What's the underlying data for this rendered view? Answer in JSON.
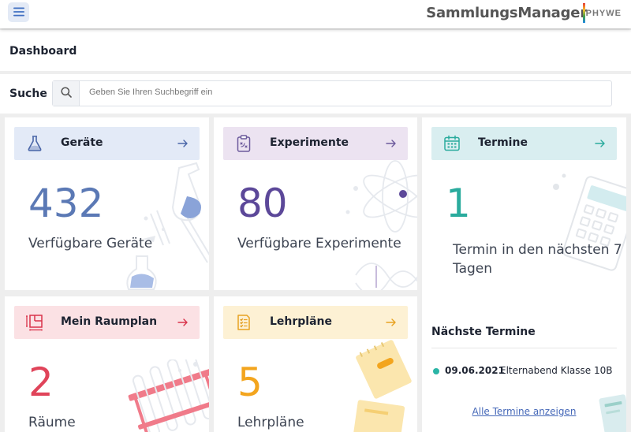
{
  "header": {
    "app_title": "SammlungsManager",
    "brand": "PHYWE",
    "menu_icon": "hamburger-menu-icon"
  },
  "page": {
    "title": "Dashboard"
  },
  "search": {
    "label": "Suche",
    "placeholder": "Geben Sie Ihren Suchbegriff ein",
    "value": "",
    "icon": "search-icon"
  },
  "cards": {
    "geraete": {
      "title": "Geräte",
      "count": "432",
      "label": "Verfügbare Geräte",
      "icon": "flask-icon",
      "header_color": "#e3eaf7",
      "number_color": "#5b79b5",
      "icon_color": "#4a66a8"
    },
    "experimente": {
      "title": "Experimente",
      "count": "80",
      "label": "Verfügbare Experimente",
      "icon": "clipboard-icon",
      "header_color": "#ece3f1",
      "number_color": "#5c4899",
      "icon_color": "#6c5a9c"
    },
    "termine": {
      "title": "Termine",
      "count": "1",
      "label": "Termin in den nächsten 7 Tagen",
      "icon": "calendar-icon",
      "header_color": "#d9eef0",
      "number_color": "#2aab9d",
      "icon_color": "#2aab9d"
    },
    "raumplan": {
      "title": "Mein Raumplan",
      "count": "2",
      "label": "Räume",
      "icon": "floorplan-icon",
      "header_color": "#fbe1e4",
      "number_color": "#e0445a",
      "icon_color": "#d9334b"
    },
    "lehrplaene": {
      "title": "Lehrpläne",
      "count": "5",
      "label": "Lehrpläne",
      "icon": "checklist-icon",
      "header_color": "#fdf1d4",
      "number_color": "#f3a51e",
      "icon_color": "#e8a221"
    }
  },
  "upcoming": {
    "title": "Nächste Termine",
    "events": [
      {
        "date": "09.06.2021",
        "name": "Elternabend Klasse 10B"
      }
    ],
    "all_link": "Alle Termine anzeigen"
  }
}
